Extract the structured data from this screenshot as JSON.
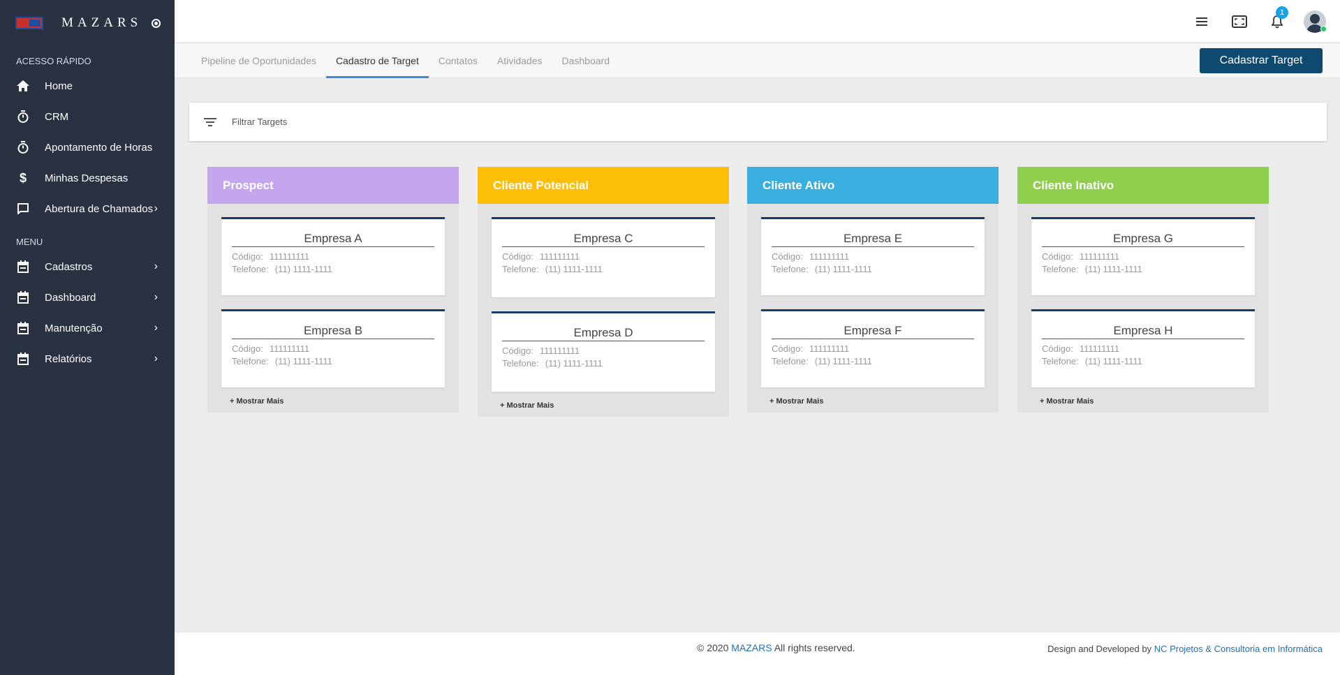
{
  "brand": {
    "name": "MAZARS"
  },
  "sidebar": {
    "quick_access_label": "ACESSO RÁPIDO",
    "quick_items": [
      {
        "label": "Home",
        "icon": "home-icon"
      },
      {
        "label": "CRM",
        "icon": "timer-icon"
      },
      {
        "label": "Apontamento de Horas",
        "icon": "timer-icon"
      },
      {
        "label": "Minhas Despesas",
        "icon": "dollar-icon"
      },
      {
        "label": "Abertura de Chamados",
        "icon": "chat-icon"
      }
    ],
    "menu_label": "MENU",
    "menu_items": [
      {
        "label": "Cadastros",
        "icon": "calendar-icon"
      },
      {
        "label": "Dashboard",
        "icon": "calendar-icon"
      },
      {
        "label": "Manutenção",
        "icon": "calendar-icon"
      },
      {
        "label": "Relatórios",
        "icon": "calendar-icon"
      }
    ]
  },
  "header": {
    "notifications_count": "1"
  },
  "tabs": [
    {
      "label": "Pipeline de Oportunidades"
    },
    {
      "label": "Cadastro de Target"
    },
    {
      "label": "Contatos"
    },
    {
      "label": "Atividades"
    },
    {
      "label": "Dashboard"
    }
  ],
  "active_tab": "Cadastro de Target",
  "primary_action": {
    "label": "Cadastrar Target"
  },
  "filter": {
    "label": "Filtrar Targets"
  },
  "board": {
    "code_label": "Código:",
    "phone_label": "Telefone:",
    "show_more_label": "+ Mostrar Mais",
    "columns": [
      {
        "title": "Prospect",
        "color": "#c4a6ef",
        "cards": [
          {
            "name": "Empresa A",
            "code": "111111111",
            "phone": "(11) 1111-1111"
          },
          {
            "name": "Empresa B",
            "code": "111111111",
            "phone": "(11) 1111-1111"
          }
        ]
      },
      {
        "title": "Cliente Potencial",
        "color": "#fdbe07",
        "cards": [
          {
            "name": "Empresa C",
            "code": "111111111",
            "phone": "(11) 1111-1111"
          },
          {
            "name": "Empresa D",
            "code": "111111111",
            "phone": "(11) 1111-1111"
          }
        ]
      },
      {
        "title": "Cliente Ativo",
        "color": "#3aaede",
        "cards": [
          {
            "name": "Empresa E",
            "code": "111111111",
            "phone": "(11) 1111-1111"
          },
          {
            "name": "Empresa F",
            "code": "111111111",
            "phone": "(11) 1111-1111"
          }
        ]
      },
      {
        "title": "Cliente Inativo",
        "color": "#8fcf4d",
        "cards": [
          {
            "name": "Empresa G",
            "code": "111111111",
            "phone": "(11) 1111-1111"
          },
          {
            "name": "Empresa H",
            "code": "111111111",
            "phone": "(11) 1111-1111"
          }
        ]
      }
    ]
  },
  "footer": {
    "copyright_prefix": "© 2020",
    "copyright_brand": "MAZARS",
    "copyright_suffix": "All rights reserved.",
    "credit_prefix": "Design and Developed by",
    "credit_link": "NC Projetos & Consultoria em Informática"
  }
}
